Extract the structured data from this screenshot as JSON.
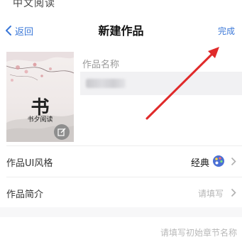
{
  "status_bar": {
    "fragment": "中文阅读"
  },
  "navbar": {
    "back_label": "返回",
    "title": "新建作品",
    "done_label": "完成"
  },
  "cover": {
    "logo_glyph": "书",
    "brand_text": "书夕阅读"
  },
  "work_name": {
    "label": "作品名称"
  },
  "ui_style": {
    "label": "作品UI风格",
    "value": "经典"
  },
  "intro": {
    "label": "作品简介",
    "placeholder": "请填写"
  },
  "chapter": {
    "placeholder": "请填写初始章节名称"
  },
  "colors": {
    "accent": "#3b78d8",
    "annotation_arrow": "#e02a2a"
  }
}
